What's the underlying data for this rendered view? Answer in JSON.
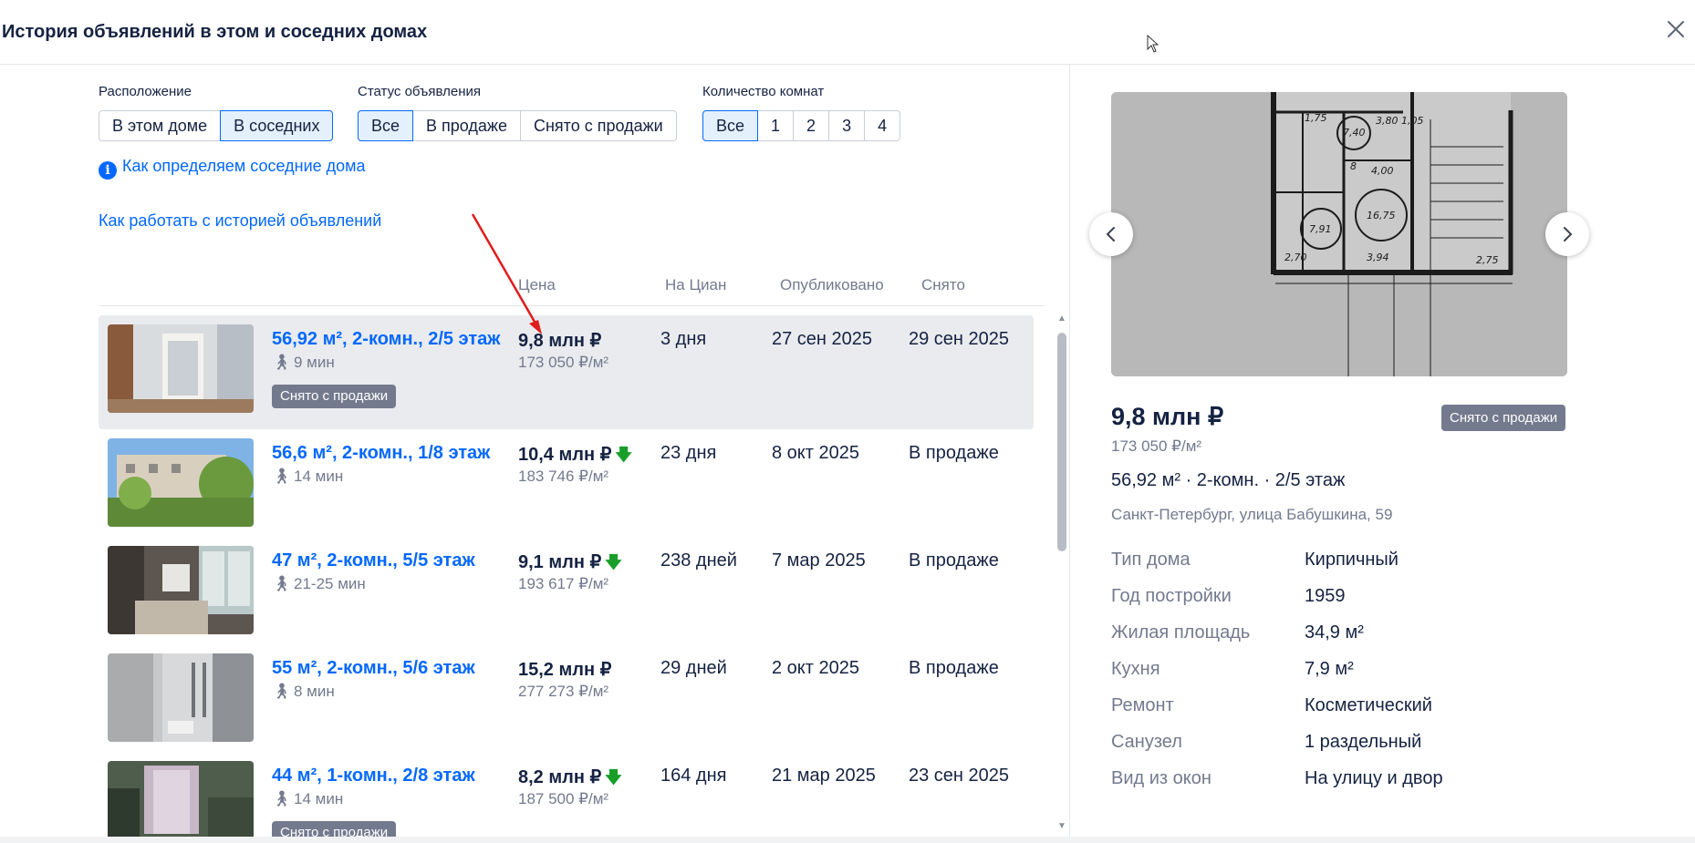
{
  "header": {
    "title": "История объявлений в этом и соседних домах"
  },
  "filters": {
    "location": {
      "label": "Расположение",
      "options": [
        "В этом доме",
        "В соседних"
      ],
      "active": 1
    },
    "status": {
      "label": "Статус объявления",
      "options": [
        "Все",
        "В продаже",
        "Снято с продажи"
      ],
      "active": 0
    },
    "rooms": {
      "label": "Количество комнат",
      "options": [
        "Все",
        "1",
        "2",
        "3",
        "4"
      ],
      "active": 0
    }
  },
  "links": {
    "neighbors_info": "Как определяем соседние дома",
    "history_help": "Как работать с историей объявлений"
  },
  "table": {
    "columns": [
      "Цена",
      "На Циан",
      "Опубликовано",
      "Снято"
    ],
    "rows": [
      {
        "title": "56,92 м², 2-комн., 2/5 этаж",
        "walk": "9 мин",
        "badge": "Снято с продажи",
        "price": "9,8 млн ₽",
        "price_down": false,
        "ppm": "173 050 ₽/м²",
        "on_cian": "3 дня",
        "published": "27 сен 2025",
        "removed": "29 сен 2025"
      },
      {
        "title": "56,6 м², 2-комн., 1/8 этаж",
        "walk": "14 мин",
        "badge": "",
        "price": "10,4 млн ₽",
        "price_down": true,
        "ppm": "183 746 ₽/м²",
        "on_cian": "23 дня",
        "published": "8 окт 2025",
        "removed": "В продаже"
      },
      {
        "title": "47 м², 2-комн., 5/5 этаж",
        "walk": "21-25 мин",
        "badge": "",
        "price": "9,1 млн ₽",
        "price_down": true,
        "ppm": "193 617 ₽/м²",
        "on_cian": "238 дней",
        "published": "7 мар 2025",
        "removed": "В продаже"
      },
      {
        "title": "55 м², 2-комн., 5/6 этаж",
        "walk": "8 мин",
        "badge": "",
        "price": "15,2 млн ₽",
        "price_down": false,
        "ppm": "277 273 ₽/м²",
        "on_cian": "29 дней",
        "published": "2 окт 2025",
        "removed": "В продаже"
      },
      {
        "title": "44 м², 1-комн., 2/8 этаж",
        "walk": "14 мин",
        "badge": "Снято с продажи",
        "price": "8,2 млн ₽",
        "price_down": true,
        "ppm": "187 500 ₽/м²",
        "on_cian": "164 дня",
        "published": "21 мар 2025",
        "removed": "23 сен 2025"
      }
    ]
  },
  "detail": {
    "price": "9,8 млн ₽",
    "badge": "Снято с продажи",
    "ppm": "173 050 ₽/м²",
    "summary": "56,92 м² · 2-комн. · 2/5 этаж",
    "address": "Санкт-Петербург, улица Бабушкина, 59",
    "params": [
      {
        "k": "Тип дома",
        "v": "Кирпичный"
      },
      {
        "k": "Год постройки",
        "v": "1959"
      },
      {
        "k": "Жилая площадь",
        "v": "34,9 м²"
      },
      {
        "k": "Кухня",
        "v": "7,9 м²"
      },
      {
        "k": "Ремонт",
        "v": "Косметический"
      },
      {
        "k": "Санузел",
        "v": "1 раздельный"
      },
      {
        "k": "Вид из окон",
        "v": "На улицу и двор"
      }
    ],
    "floorplan_labels": [
      "2,70",
      "3,94",
      "2,75",
      "7,40",
      "7,91",
      "16,75",
      "4,00",
      "3,80",
      "1,05",
      "1,75",
      "8"
    ]
  },
  "icons": {
    "close": "close-icon",
    "info": "info-icon",
    "walk": "pedestrian-icon",
    "down": "arrow-down-icon",
    "prev": "chevron-left-icon",
    "next": "chevron-right-icon"
  },
  "colors": {
    "link": "#0468ff",
    "badge": "#737a8e",
    "selected_row": "#e9ebee",
    "price_down": "#1a9e2a"
  }
}
